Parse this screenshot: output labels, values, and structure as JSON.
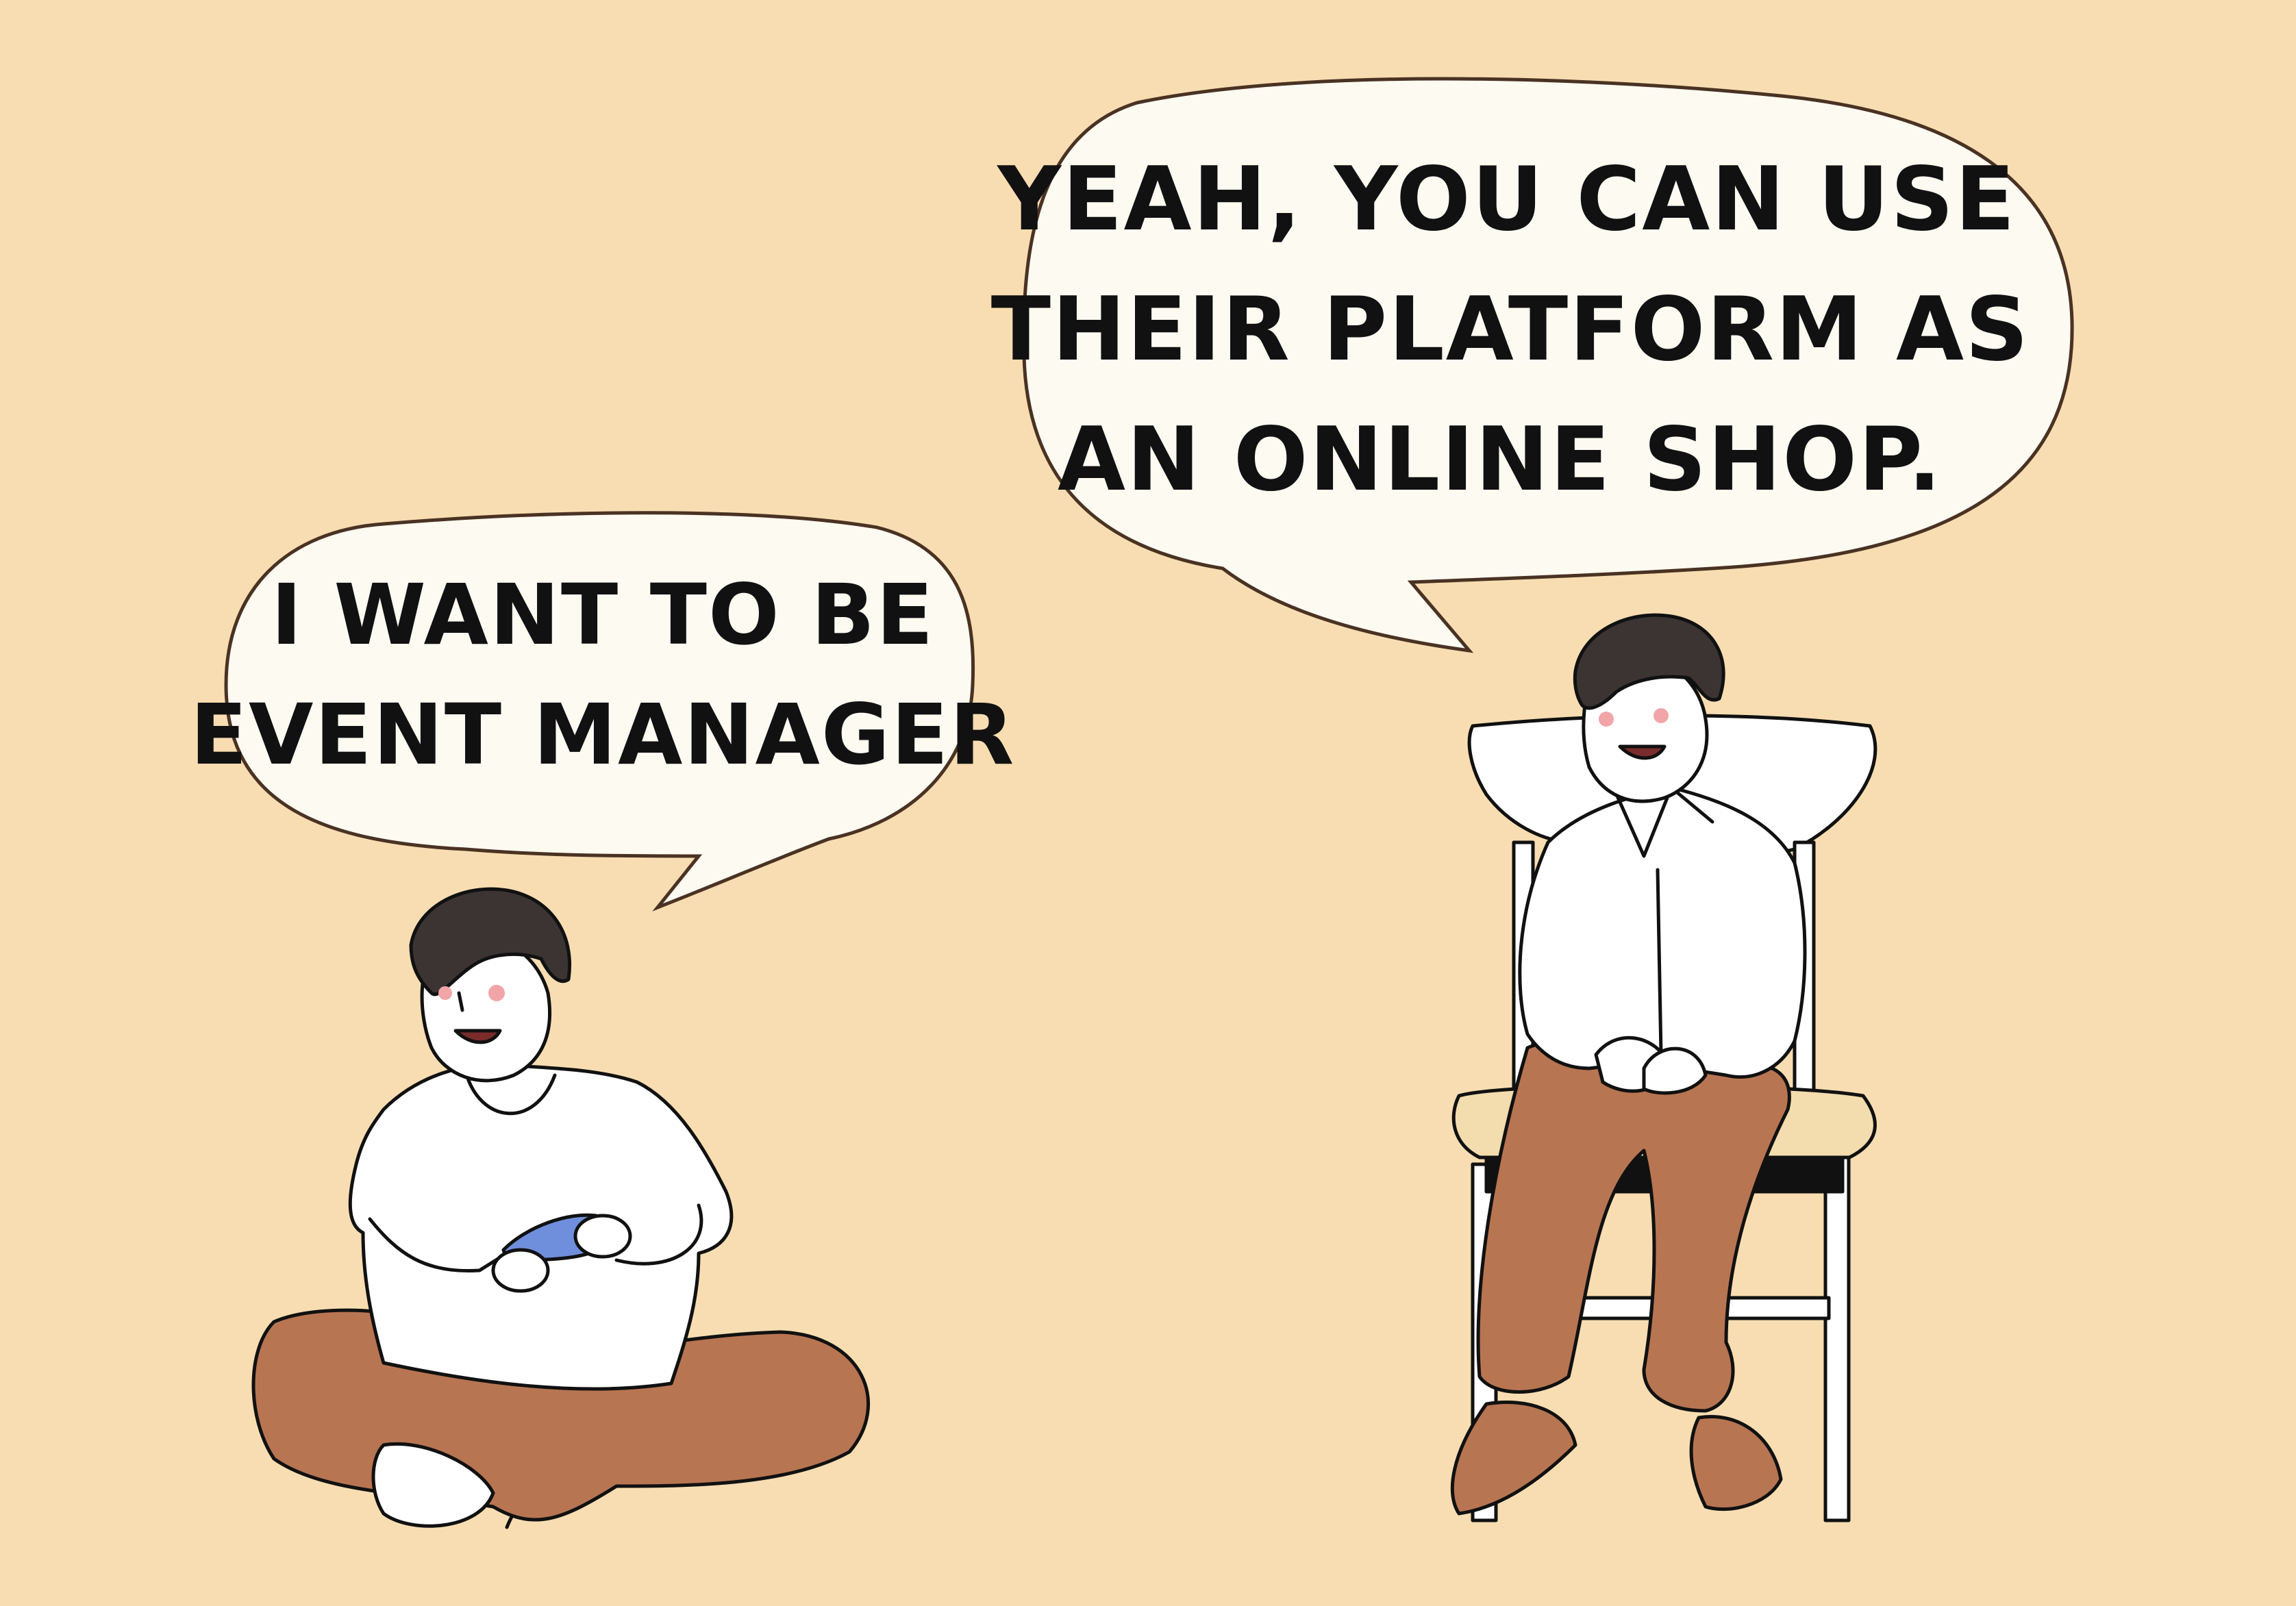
{
  "colors": {
    "background": "#f7ddb1",
    "bubble_fill": "#fdfaf2",
    "bubble_outline": "#4a3223",
    "ink": "#111111",
    "pants": "#b87552",
    "hair": "#3b3433",
    "shirt": "#ffffff",
    "controller": "#6f8fdc",
    "seat": "#f3dcae",
    "blush": "#f2a5a8"
  },
  "left_bubble": {
    "lines": [
      "I WANT TO BE",
      "EVENT MANAGER"
    ]
  },
  "right_bubble": {
    "lines": [
      "YEAH, YOU CAN USE",
      "THEIR PLATFORM AS",
      "AN ONLINE SHOP."
    ]
  }
}
